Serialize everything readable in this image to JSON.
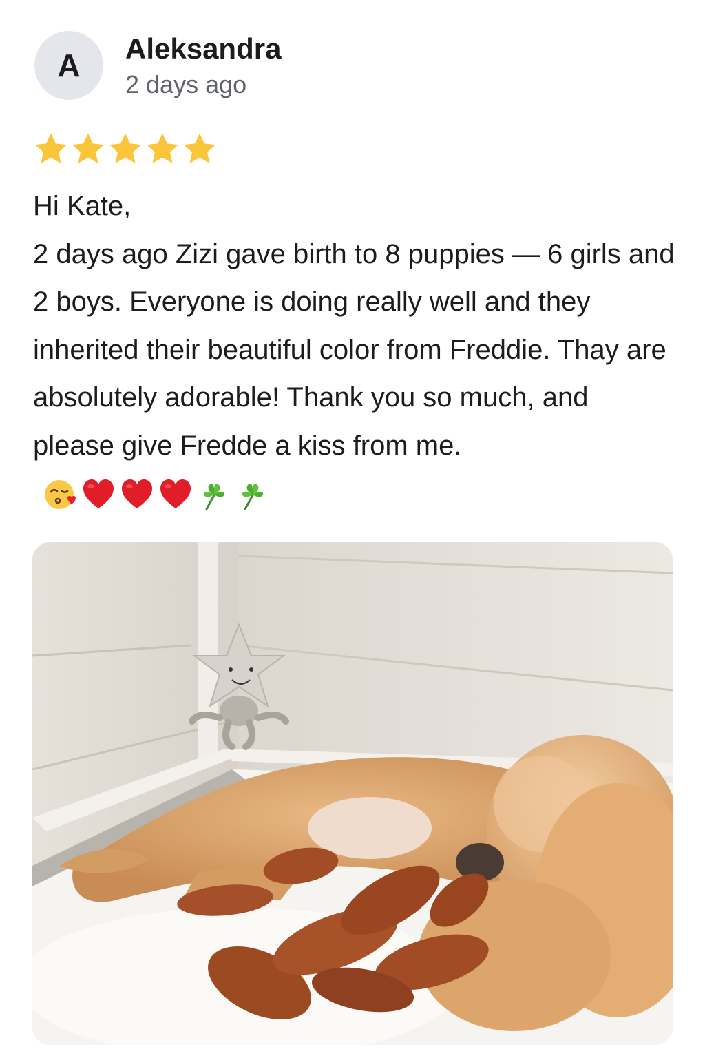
{
  "review": {
    "avatar_initial": "A",
    "author": "Aleksandra",
    "time": "2 days ago",
    "rating": 5,
    "star_color": "#fbc53a",
    "greeting": "Hi Kate,",
    "message": "2 days ago Zizi gave birth to 8 puppies — 6 girls and 2 boys. Everyone is doing really well and they inherited their beautiful color from Freddie. Thay are absolutely adorable! Thank you so much, and please give Fredde a kiss from me.",
    "emojis": [
      "kissing-face-with-heart-icon",
      "red-heart-icon",
      "red-heart-icon",
      "red-heart-icon",
      "shamrock-icon",
      "shamrock-icon"
    ]
  },
  "photo": {
    "subject": "photo"
  }
}
